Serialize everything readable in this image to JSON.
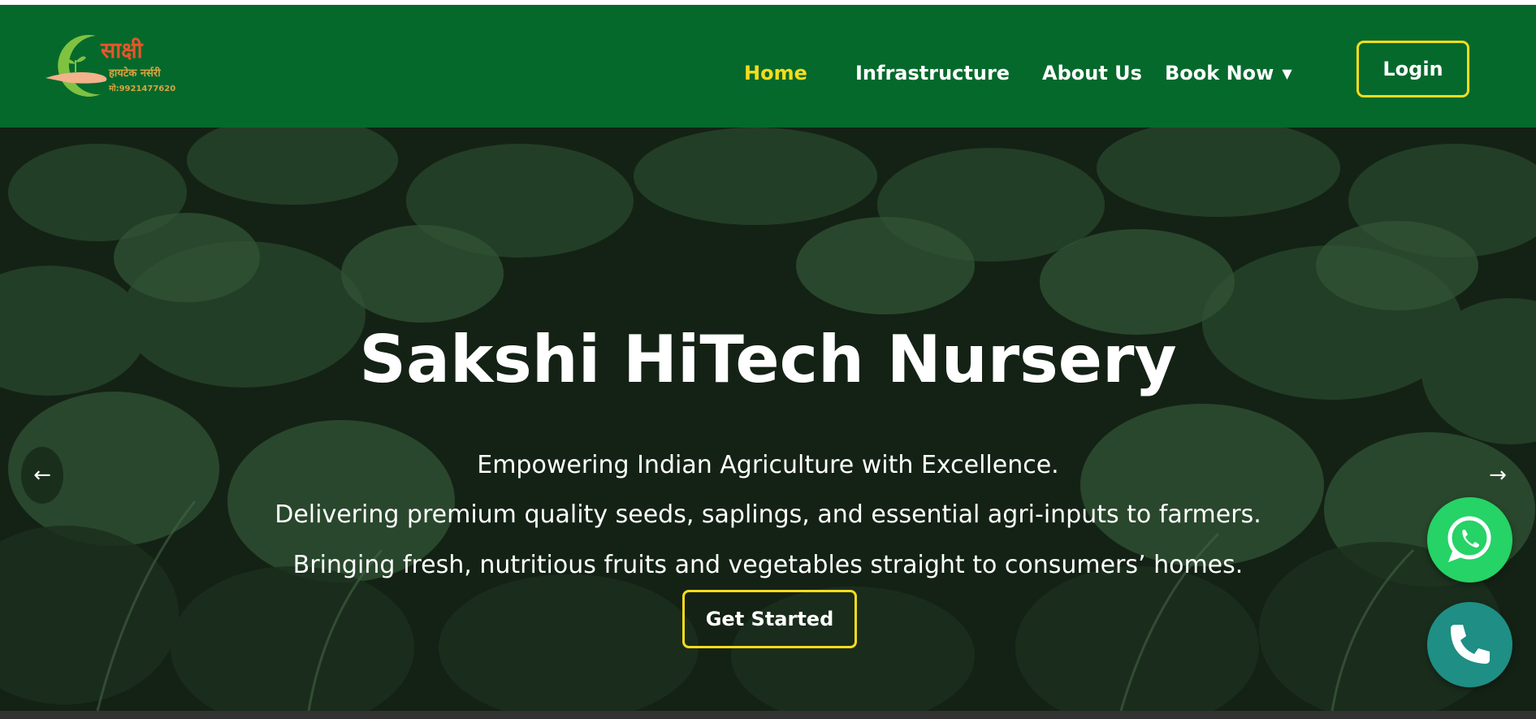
{
  "header": {
    "logo": {
      "title": "साक्षी",
      "subtitle": "हायटेक नर्सरी",
      "phone": "मो:9921477620"
    },
    "nav": [
      {
        "label": "Home",
        "active": true
      },
      {
        "label": "Infrastructure",
        "active": false
      },
      {
        "label": "About Us",
        "active": false
      },
      {
        "label": "Book Now",
        "active": false,
        "dropdown": true
      }
    ],
    "login_label": "Login"
  },
  "hero": {
    "title": "Sakshi HiTech Nursery",
    "lines": [
      "Empowering Indian Agriculture with Excellence.",
      "Delivering premium quality seeds, saplings, and essential agri-inputs to farmers.",
      "Bringing fresh, nutritious fruits and vegetables straight to consumers’ homes."
    ],
    "cta_label": "Get Started",
    "prev_arrow": "←",
    "next_arrow": "→"
  },
  "floating": {
    "whatsapp_icon": "whatsapp-icon",
    "phone_icon": "phone-icon"
  },
  "colors": {
    "header_bg": "#05692c",
    "accent_yellow": "#f6dc1e",
    "whatsapp_green": "#25d366",
    "phone_teal": "#1f8e84"
  }
}
